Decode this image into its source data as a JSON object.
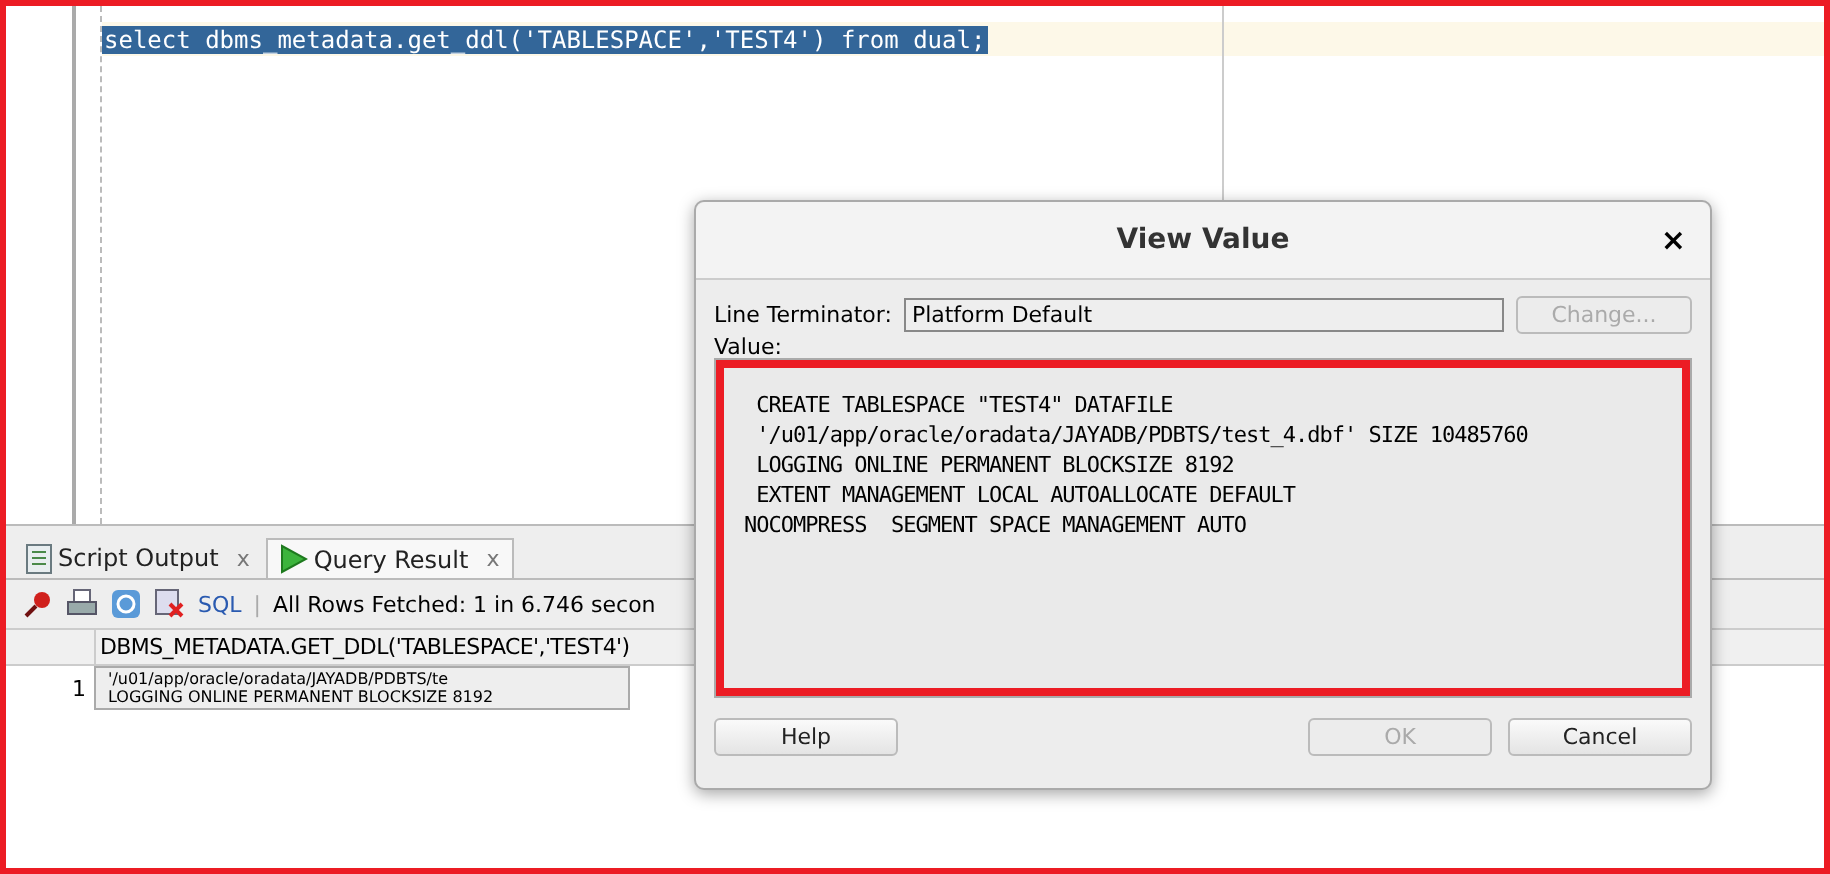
{
  "editor": {
    "code": "select dbms_metadata.get_ddl('TABLESPACE','TEST4') from dual;"
  },
  "tabs": [
    {
      "label": "Script Output",
      "selected": false,
      "close": "x"
    },
    {
      "label": "Query Result",
      "selected": true,
      "close": "x"
    }
  ],
  "toolbar": {
    "sql": "SQL",
    "separator": "|",
    "status": "All Rows Fetched: 1 in 6.746 secon"
  },
  "table": {
    "columns": [
      "DBMS_METADATA.GET_DDL('TABLESPACE','TEST4')"
    ],
    "rows": [
      {
        "number": "1",
        "lines": [
          "'/u01/app/oracle/oradata/JAYADB/PDBTS/te",
          "LOGGING ONLINE PERMANENT BLOCKSIZE 8192"
        ]
      }
    ]
  },
  "dialog": {
    "title": "View Value",
    "close": "×",
    "terminator_label": "Line Terminator:",
    "terminator_value": "Platform Default",
    "change_button": {
      "label": "Change...",
      "disabled": true
    },
    "value_label": "Value:",
    "value_lines": [
      " CREATE TABLESPACE \"TEST4\" DATAFILE",
      " '/u01/app/oracle/oradata/JAYADB/PDBTS/test_4.dbf' SIZE 10485760",
      " LOGGING ONLINE PERMANENT BLOCKSIZE 8192",
      " EXTENT MANAGEMENT LOCAL AUTOALLOCATE DEFAULT",
      "NOCOMPRESS  SEGMENT SPACE MANAGEMENT AUTO"
    ],
    "buttons": [
      {
        "label": "Help",
        "disabled": false
      },
      {
        "label": "OK",
        "disabled": true
      },
      {
        "label": "Cancel",
        "disabled": false
      }
    ]
  }
}
